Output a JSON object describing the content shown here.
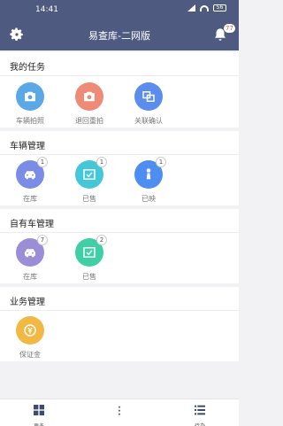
{
  "status_bar": {
    "time": "14:41",
    "battery": "56"
  },
  "header": {
    "title": "易查库-二网版",
    "notification_count": "77"
  },
  "sections": [
    {
      "title": "我的任务",
      "items": [
        {
          "label": "车辆拍照",
          "icon": "camera-icon",
          "color": "#5aa9e6"
        },
        {
          "label": "退回重拍",
          "icon": "camera-icon",
          "color": "#ef8a76"
        },
        {
          "label": "关联确认",
          "icon": "link-icon",
          "color": "#5b8def"
        }
      ]
    },
    {
      "title": "车辆管理",
      "items": [
        {
          "label": "在库",
          "icon": "car-icon",
          "color": "#7b8ce6",
          "badge": "1"
        },
        {
          "label": "已售",
          "icon": "check-box-icon",
          "color": "#44c7d9",
          "badge": "1"
        },
        {
          "label": "已映",
          "icon": "person-tie-icon",
          "color": "#4d8ef0",
          "badge": "1"
        }
      ]
    },
    {
      "title": "自有车管理",
      "items": [
        {
          "label": "在库",
          "icon": "car-icon",
          "color": "#9b8ed6",
          "badge": "7"
        },
        {
          "label": "已售",
          "icon": "check-box-icon",
          "color": "#3ecfa4",
          "badge": "2"
        }
      ]
    },
    {
      "title": "业务管理",
      "items": [
        {
          "label": "保证金",
          "icon": "yen-icon",
          "color": "#f2b844"
        }
      ]
    }
  ],
  "bottom_nav": [
    {
      "label": "更多",
      "icon": "grid-icon"
    },
    {
      "label": "",
      "icon": "dots-vertical-icon"
    },
    {
      "label": "待办",
      "icon": "list-icon"
    }
  ]
}
